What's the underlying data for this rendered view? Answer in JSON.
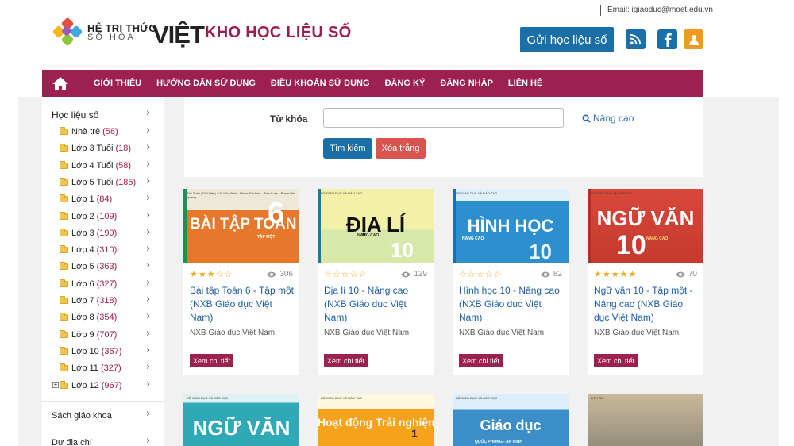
{
  "header": {
    "email": "Email: igiaoduc@moet.edu.vn",
    "logo_line1": "HỆ TRI THỨC",
    "logo_line2": "SỐ HÓA",
    "logo_big": "VIỆT",
    "site_title": "KHO HỌC LIỆU SỐ",
    "submit_button": "Gửi học liệu số",
    "social_icons": [
      "rss-icon",
      "facebook-icon",
      "user-icon"
    ],
    "colors": {
      "brand": "#9c2150",
      "button_blue": "#1a6fa8",
      "rss": "#1a6fa8",
      "facebook": "#1a6fa8",
      "user": "#f09a20"
    }
  },
  "nav": {
    "home_icon": "home-icon",
    "items": [
      "GIỚI THIỆU",
      "HƯỚNG DẪN SỬ DỤNG",
      "ĐIỀU KHOẢN SỬ DỤNG",
      "ĐĂNG KÝ",
      "ĐĂNG NHẬP",
      "LIÊN HỆ"
    ]
  },
  "sidebar": {
    "section1": "Học liệu số",
    "items": [
      {
        "label": "Nhà trẻ",
        "count": "(58)"
      },
      {
        "label": "Lớp 3 Tuổi",
        "count": "(18)"
      },
      {
        "label": "Lớp 4 Tuổi",
        "count": "(58)"
      },
      {
        "label": "Lớp 5 Tuổi",
        "count": "(185)"
      },
      {
        "label": "Lớp 1",
        "count": "(84)"
      },
      {
        "label": "Lớp 2",
        "count": "(109)"
      },
      {
        "label": "Lớp 3",
        "count": "(199)"
      },
      {
        "label": "Lớp 4",
        "count": "(310)"
      },
      {
        "label": "Lớp 5",
        "count": "(363)"
      },
      {
        "label": "Lớp 6",
        "count": "(327)"
      },
      {
        "label": "Lớp 7",
        "count": "(318)"
      },
      {
        "label": "Lớp 8",
        "count": "(354)"
      },
      {
        "label": "Lớp 9",
        "count": "(707)"
      },
      {
        "label": "Lớp 10",
        "count": "(367)"
      },
      {
        "label": "Lớp 11",
        "count": "(327)"
      },
      {
        "label": "Lớp 12",
        "count": "(967)"
      }
    ],
    "section2": "Sách giáo khoa",
    "section3": "Dự địa chí"
  },
  "search": {
    "keyword_label": "Từ khóa",
    "keyword_value": "",
    "advanced": "Nâng cao",
    "search_button": "Tìm kiếm",
    "clear_button": "Xóa trắng"
  },
  "books": [
    {
      "title": "Bài tập Toán 6 - Tập một (NXB Giáo dục Việt Nam)",
      "publisher": "NXB Giáo dục Việt Nam",
      "views": "306",
      "rating": 3,
      "detail": "Xem chi tiết",
      "cover_top": "Tôn Thân (Chủ biên) · Vũ Hữu Bình · Phạm Gia Đức · Trần Luận · Phạm Bác Quang",
      "cover_title": "BÀI TẬP TOÁN",
      "cover_num": "6",
      "cover_sub": "TẬP MỘT"
    },
    {
      "title": "Địa lí 10 - Nâng cao (NXB Giáo dục Việt Nam)",
      "publisher": "NXB Giáo dục Việt Nam",
      "views": "129",
      "rating": 0,
      "detail": "Xem chi tiết",
      "cover_top": "BỘ GIÁO DỤC VÀ ĐÀO TẠO",
      "cover_title": "ĐỊA LÍ",
      "cover_num": "10",
      "cover_sub": "NÂNG CAO"
    },
    {
      "title": "Hình học 10 - Nâng cao (NXB Giáo dục Việt Nam)",
      "publisher": "NXB Giáo dục Việt Nam",
      "views": "82",
      "rating": 0,
      "detail": "Xem chi tiết",
      "cover_top": "BỘ GIÁO DỤC VÀ ĐÀO TẠO",
      "cover_title": "HÌNH HỌC",
      "cover_num": "10",
      "cover_sub": "NÂNG CAO"
    },
    {
      "title": "Ngữ văn 10 - Tập một - Nâng cao (NXB Giáo dục Việt Nam)",
      "publisher": "NXB Giáo dục Việt Nam",
      "views": "70",
      "rating": 5,
      "detail": "Xem chi tiết",
      "cover_top": "BỘ GIÁO DỤC VÀ ĐÀO TẠO",
      "cover_title": "NGỮ VĂN",
      "cover_num": "10",
      "cover_sub": "NÂNG CAO"
    },
    {
      "cover_top": "BỘ GIÁO DỤC VÀ ĐÀO TẠO",
      "cover_title": "NGỮ VĂN"
    },
    {
      "cover_top": "BỘ GIÁO DỤC VÀ ĐÀO TẠO",
      "cover_title": "Hoạt động Trải nghiệm",
      "cover_num": "1"
    },
    {
      "cover_top": "BỘ GIÁO DỤC VÀ ĐÀO TẠO",
      "cover_title": "Giáo dục",
      "cover_sub": "QUỐC PHÒNG - AN NINH"
    },
    {
      "cover_top": "LỊCH SỬ"
    }
  ]
}
